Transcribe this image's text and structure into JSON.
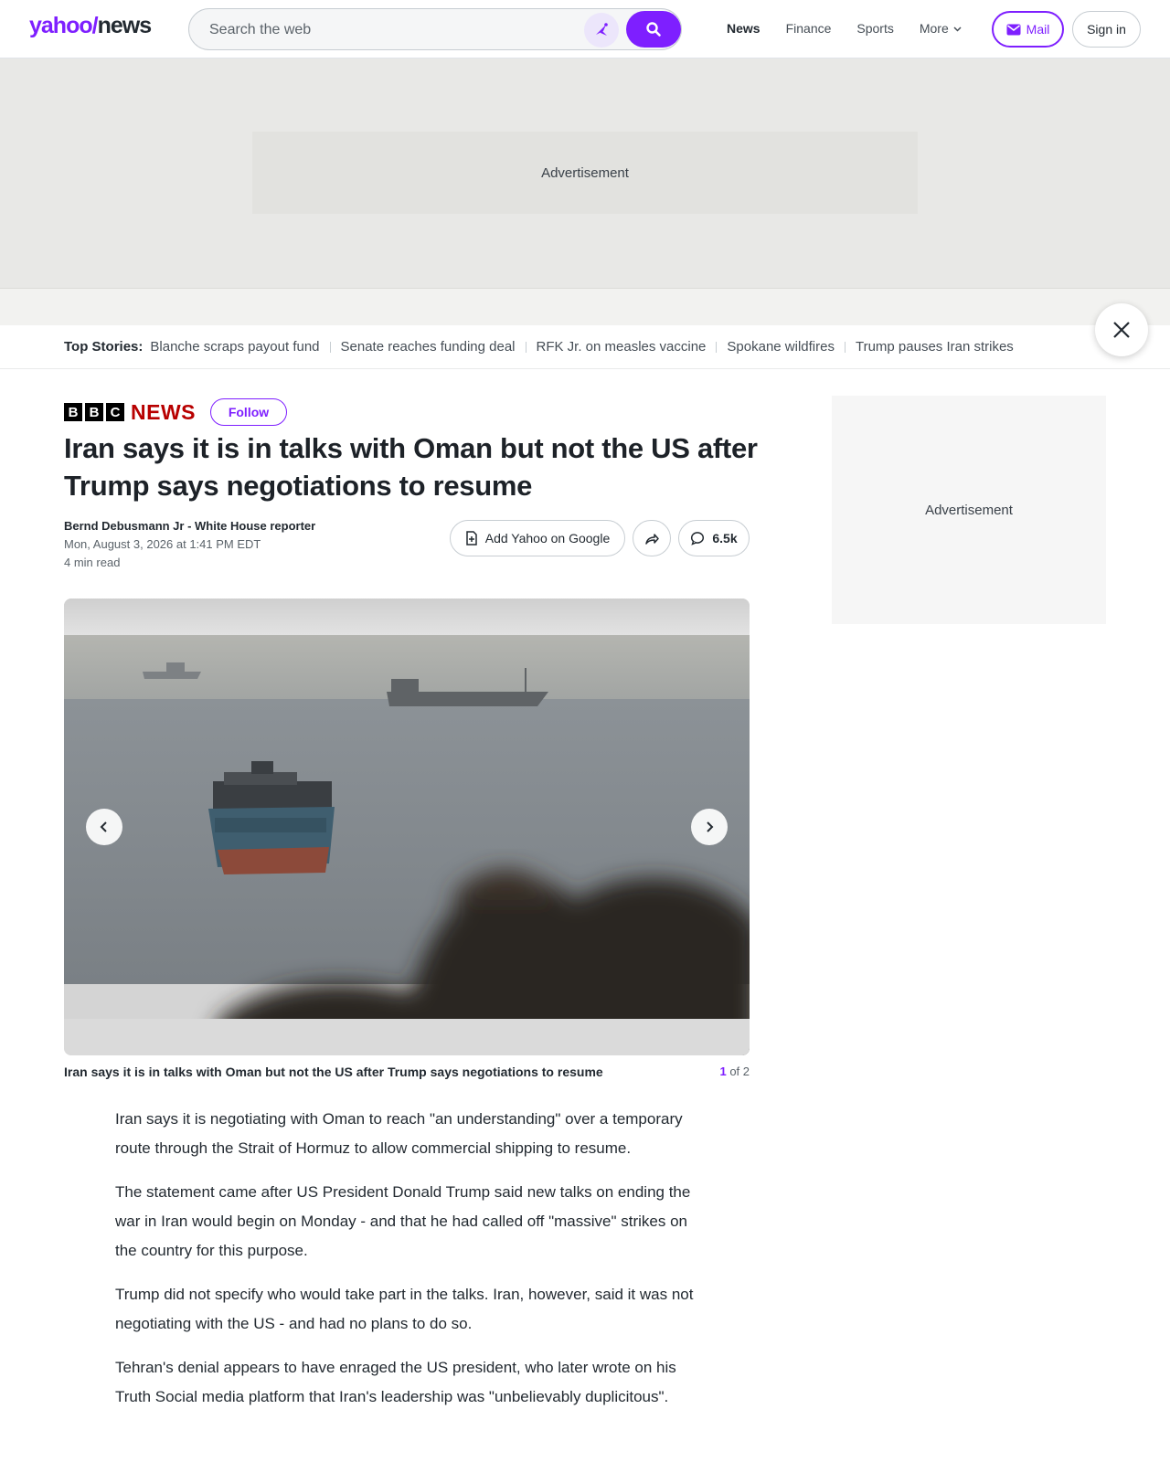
{
  "header": {
    "logo_yahoo": "yahoo",
    "logo_slash": "/",
    "logo_news": "news",
    "search_placeholder": "Search the web",
    "nav": [
      "News",
      "Finance",
      "Sports",
      "More"
    ],
    "mail_label": "Mail",
    "signin_label": "Sign in",
    "brand_color": "#7e1fff"
  },
  "ads": {
    "top_label": "Advertisement",
    "side_label": "Advertisement"
  },
  "top_stories": {
    "label": "Top Stories:",
    "items": [
      "Blanche scraps payout fund",
      "Senate reaches funding deal",
      "RFK Jr. on measles vaccine",
      "Spokane wildfires",
      "Trump pauses Iran strikes"
    ]
  },
  "article": {
    "publisher_letters": [
      "B",
      "B",
      "C"
    ],
    "publisher_news": "NEWS",
    "follow_label": "Follow",
    "headline": "Iran says it is in talks with Oman but not the US after Trump says negotiations to resume",
    "author": "Bernd Debusmann Jr - White House reporter",
    "date": "Mon, August 3, 2026 at 1:41 PM EDT",
    "read_time": "4 min read",
    "add_google_label": "Add Yahoo on Google",
    "comment_count": "6.5k",
    "caption": "Iran says it is in talks with Oman but not the US after Trump says negotiations to resume",
    "slide_current": "1",
    "slide_total_text": " of 2",
    "paragraphs": [
      "Iran says it is negotiating with Oman to reach \"an understanding\" over a temporary route through the Strait of Hormuz to allow commercial shipping to resume.",
      "The statement came after US President Donald Trump said new talks on ending the war in Iran would begin on Monday - and that he had called off \"massive\" strikes on the country for this purpose.",
      "Trump did not specify who would take part in the talks. Iran, however, said it was not negotiating with the US - and had no plans to do so.",
      "Tehran's denial appears to have enraged the US president, who later wrote on his Truth Social media platform that Iran's leadership was \"unbelievably duplicitous\"."
    ]
  }
}
